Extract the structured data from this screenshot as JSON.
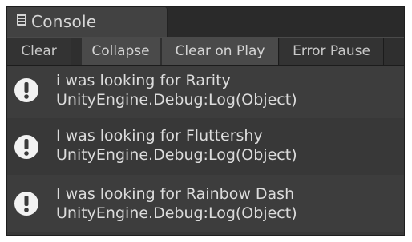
{
  "tab": {
    "title": "Console",
    "icon": "console-icon"
  },
  "toolbar": {
    "clear_label": "Clear",
    "collapse_label": "Collapse",
    "clear_on_play_label": "Clear on Play",
    "error_pause_label": "Error Pause",
    "active_buttons": [
      "Collapse",
      "Clear on Play"
    ]
  },
  "log": {
    "entries": [
      {
        "icon": "info-icon",
        "message": "i was looking for Rarity",
        "trace": "UnityEngine.Debug:Log(Object)"
      },
      {
        "icon": "info-icon",
        "message": "I was looking for Fluttershy",
        "trace": "UnityEngine.Debug:Log(Object)"
      },
      {
        "icon": "info-icon",
        "message": "I was looking for Rainbow Dash",
        "trace": "UnityEngine.Debug:Log(Object)"
      }
    ]
  },
  "colors": {
    "panel_bg": "#3a3a3a",
    "text": "#dcdcdc",
    "icon_white": "#f2f2f2"
  }
}
